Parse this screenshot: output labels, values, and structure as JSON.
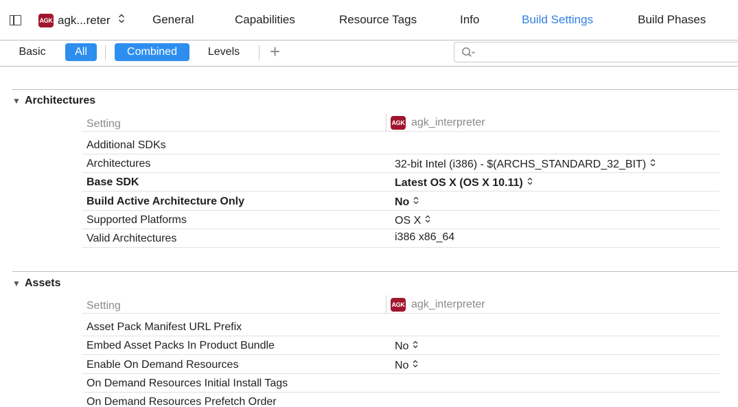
{
  "topbar": {
    "target_name": "agk...reter",
    "target_badge": "AGK",
    "target_chevron": "⌃⌄",
    "tabs": [
      {
        "label": "General",
        "active": false
      },
      {
        "label": "Capabilities",
        "active": false
      },
      {
        "label": "Resource Tags",
        "active": false
      },
      {
        "label": "Info",
        "active": false
      },
      {
        "label": "Build Settings",
        "active": true
      },
      {
        "label": "Build Phases",
        "active": false
      }
    ],
    "accent_color": "#2f7fe0"
  },
  "filterbar": {
    "basic": "Basic",
    "all": "All",
    "combined": "Combined",
    "levels": "Levels",
    "plus": "+",
    "search_value": "",
    "selected_color": "#2d8ef0"
  },
  "sections": [
    {
      "title": "Architectures",
      "header": {
        "setting": "Setting",
        "target_badge": "AGK",
        "target": "agk_interpreter"
      },
      "rows": [
        {
          "name": "Additional SDKs",
          "value": "",
          "chevron": false,
          "bold": false
        },
        {
          "name": "Architectures",
          "value": "32-bit Intel (i386)  -  $(ARCHS_STANDARD_32_BIT)",
          "chevron": true,
          "bold": false
        },
        {
          "name": "Base SDK",
          "value": "Latest OS X (OS X 10.11)",
          "chevron": true,
          "bold": true
        },
        {
          "name": "Build Active Architecture Only",
          "value": "No",
          "chevron": true,
          "bold": true
        },
        {
          "name": "Supported Platforms",
          "value": "OS X",
          "chevron": true,
          "bold": false
        },
        {
          "name": "Valid Architectures",
          "value": "i386 x86_64",
          "chevron": false,
          "bold": false
        }
      ]
    },
    {
      "title": "Assets",
      "header": {
        "setting": "Setting",
        "target_badge": "AGK",
        "target": "agk_interpreter"
      },
      "rows": [
        {
          "name": "Asset Pack Manifest URL Prefix",
          "value": "",
          "chevron": false,
          "bold": false
        },
        {
          "name": "Embed Asset Packs In Product Bundle",
          "value": "No",
          "chevron": true,
          "bold": false
        },
        {
          "name": "Enable On Demand Resources",
          "value": "No",
          "chevron": true,
          "bold": false
        },
        {
          "name": "On Demand Resources Initial Install Tags",
          "value": "",
          "chevron": false,
          "bold": false
        },
        {
          "name": "On Demand Resources Prefetch Order",
          "value": "",
          "chevron": false,
          "bold": false
        }
      ]
    }
  ],
  "icons": {
    "sidebar_toggle": "sidebar-toggle-icon",
    "search": "search-icon",
    "disclosure": "▼",
    "chevron": "updown-chevron-icon"
  }
}
